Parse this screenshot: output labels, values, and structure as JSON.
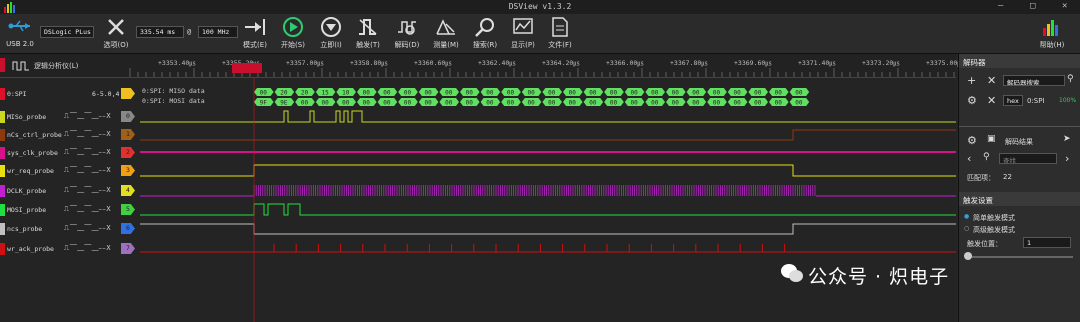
{
  "window": {
    "title": "DSView v1.3.2",
    "minimize": "—",
    "maximize": "□",
    "close": "✕"
  },
  "toolbar": {
    "usb_label": "USB 2.0",
    "device_select": "DSLogic PLus",
    "options_label": "选项(O)",
    "sample_time": "335.54 ms",
    "at_sign": "@",
    "sample_rate": "100 MHz",
    "mode_label": "模式(E)",
    "start_label": "开始(S)",
    "instant_label": "立即(I)",
    "trigger_label": "触发(T)",
    "decode_label": "解码(D)",
    "measure_label": "测量(M)",
    "search_label": "搜索(R)",
    "display_label": "显示(P)",
    "file_label": "文件(F)",
    "help_label": "帮助(H)",
    "brand_colors": {
      "dark": "#1e1e1e",
      "accent_green": "#2ecc71"
    }
  },
  "ruler": {
    "ticks": [
      "+3353.40㎲",
      "+3355.20㎲",
      "+3357.00㎲",
      "+3358.80㎲",
      "+3360.60㎲",
      "+3362.40㎲",
      "+3364.20㎲",
      "+3366.00㎲",
      "+3367.80㎲",
      "+3369.60㎲",
      "+3371.40㎲",
      "+3373.20㎲",
      "+3375.00㎲"
    ],
    "logic_label": "逻辑分析仪(L)"
  },
  "channels": [
    {
      "name": "0:SPI",
      "color": "#e0102a",
      "trig": "",
      "index": "",
      "extra": "6-5.0,4",
      "index_color": "#f0c020"
    },
    {
      "name": "MISo_probe",
      "color": "#c8d820",
      "trig": "⎍⎺⎽⎺⎽⎯⎯X",
      "index": "0",
      "index_color": "#888888"
    },
    {
      "name": "nCs_ctrl_probe",
      "color": "#8b3a10",
      "trig": "⎍⎺⎽⎺⎽⎯⎯X",
      "index": "1",
      "index_color": "#a0601a"
    },
    {
      "name": "sys_clk_probe",
      "color": "#d8108a",
      "trig": "⎍⎺⎽⎺⎽⎯⎯X",
      "index": "2",
      "index_color": "#e03030"
    },
    {
      "name": "wr_req_probe",
      "color": "#e8e010",
      "trig": "⎍⎺⎽⎺⎽⎯⎯X",
      "index": "3",
      "index_color": "#f0a010"
    },
    {
      "name": "DCLK_probe",
      "color": "#c020d0",
      "trig": "⎍⎺⎽⎺⎽⎯⎯X",
      "index": "4",
      "index_color": "#e0e020"
    },
    {
      "name": "MOSI_probe",
      "color": "#20e040",
      "trig": "⎍⎺⎽⎺⎽⎯⎯X",
      "index": "5",
      "index_color": "#40d040"
    },
    {
      "name": "ncs_probe",
      "color": "#c0c0c0",
      "trig": "⎍⎺⎽⎺⎽⎯⎯X",
      "index": "6",
      "index_color": "#3070e0"
    },
    {
      "name": "wr_ack_probe",
      "color": "#d01010",
      "trig": "⎍⎺⎽⎺⎽⎯⎯X",
      "index": "7",
      "index_color": "#a070c0"
    }
  ],
  "decode": {
    "miso_label": "0:SPI: MISO data",
    "mosi_label": "0:SPI: MOSI data",
    "miso_values": [
      "00",
      "20",
      "20",
      "15",
      "10",
      "00",
      "00",
      "00",
      "00",
      "00",
      "00",
      "00",
      "00",
      "00",
      "00",
      "00",
      "00",
      "00",
      "00",
      "00",
      "00",
      "00",
      "00",
      "00",
      "00",
      "00",
      "00"
    ],
    "mosi_values": [
      "9F",
      "9E",
      "00",
      "00",
      "00",
      "00",
      "00",
      "00",
      "00",
      "00",
      "00",
      "00",
      "00",
      "00",
      "00",
      "00",
      "00",
      "00",
      "00",
      "00",
      "00",
      "00",
      "00",
      "00",
      "00",
      "00",
      "00"
    ]
  },
  "panel": {
    "decoder_title": "解码器",
    "decoder_search": "解码器搜索",
    "decoder_format": "hex",
    "decoder_name": "0:SPI",
    "decoder_pct": "100%",
    "result_label": "解码结果",
    "search_placeholder": "查找",
    "match_label": "匹配项：",
    "match_count": "22",
    "trigger_title": "触发设置",
    "simple_trigger": "简单触发模式",
    "advanced_trigger": "高级触发模式",
    "trigger_pos": "触发位置：",
    "trigger_pos_value": "1"
  },
  "watermark": {
    "text": "公众号 · 炽电子"
  }
}
